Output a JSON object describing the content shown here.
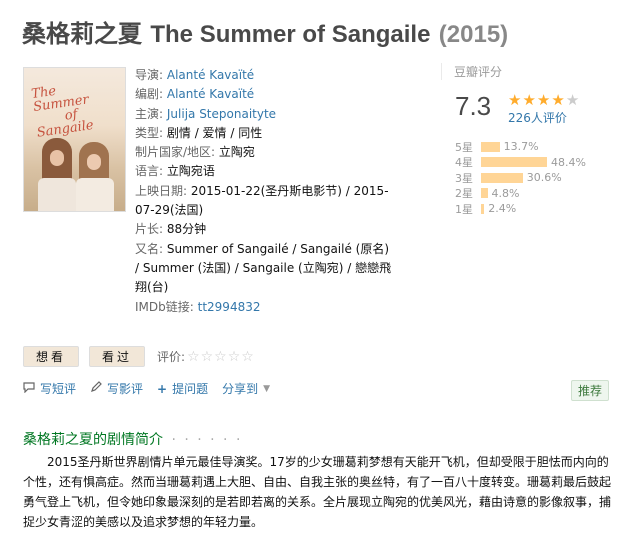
{
  "title": {
    "zh": "桑格莉之夏",
    "en": "The Summer of Sangaile",
    "year": "(2015)"
  },
  "poster": {
    "title_line1": "The",
    "title_line2": "Summer",
    "title_line3": "of",
    "title_line4": "Sangaile"
  },
  "info": {
    "director_label": "导演:",
    "director": "Alanté Kavaïté",
    "writer_label": "编剧:",
    "writer": "Alanté Kavaïté",
    "cast_label": "主演:",
    "cast": "Julija Steponaityte",
    "genre_label": "类型:",
    "genre": "剧情 / 爱情 / 同性",
    "country_label": "制片国家/地区:",
    "country": "立陶宛",
    "language_label": "语言:",
    "language": "立陶宛语",
    "release_label": "上映日期:",
    "release": "2015-01-22(圣丹斯电影节) / 2015-07-29(法国)",
    "runtime_label": "片长:",
    "runtime": "88分钟",
    "aka_label": "又名:",
    "aka": "Summer of Sangailé / Sangailé (原名) / Summer (法国) / Sangaile (立陶宛) / 戀戀飛翔(台)",
    "imdb_label": "IMDb链接:",
    "imdb": "tt2994832"
  },
  "rating": {
    "header": "豆瓣评分",
    "score": "7.3",
    "stars_filled": 4,
    "stars_total": 5,
    "count_text": "226人评价",
    "bars": [
      {
        "label": "5星",
        "percent": 13.7,
        "text": "13.7%"
      },
      {
        "label": "4星",
        "percent": 48.4,
        "text": "48.4%"
      },
      {
        "label": "3星",
        "percent": 30.6,
        "text": "30.6%"
      },
      {
        "label": "2星",
        "percent": 4.8,
        "text": "4.8%"
      },
      {
        "label": "1星",
        "percent": 2.4,
        "text": "2.4%"
      }
    ],
    "color_bar": "#ffd596",
    "color_star": "#ffac2d"
  },
  "actions": {
    "want": "想看",
    "seen": "看过",
    "evaluate_label": "评价:",
    "eval_stars": "☆☆☆☆☆"
  },
  "tools": {
    "short_comment": "写短评",
    "review": "写影评",
    "ask": "提问题",
    "share": "分享到",
    "recommend": "推荐"
  },
  "synopsis": {
    "title": "桑格莉之夏的剧情简介",
    "dots": "· · · · · ·",
    "text": "2015圣丹斯世界剧情片单元最佳导演奖。17岁的少女珊葛莉梦想有天能开飞机，但却受限于胆怯而内向的个性，还有惧高症。然而当珊葛莉遇上大胆、自由、自我主张的奥丝特，有了一百八十度转变。珊葛莉最后鼓起勇气登上飞机，但令她印象最深刻的是若即若离的关系。全片展现立陶宛的优美风光，藉由诗意的影像叙事，捕捉少女青涩的美感以及追求梦想的年轻力量。"
  }
}
